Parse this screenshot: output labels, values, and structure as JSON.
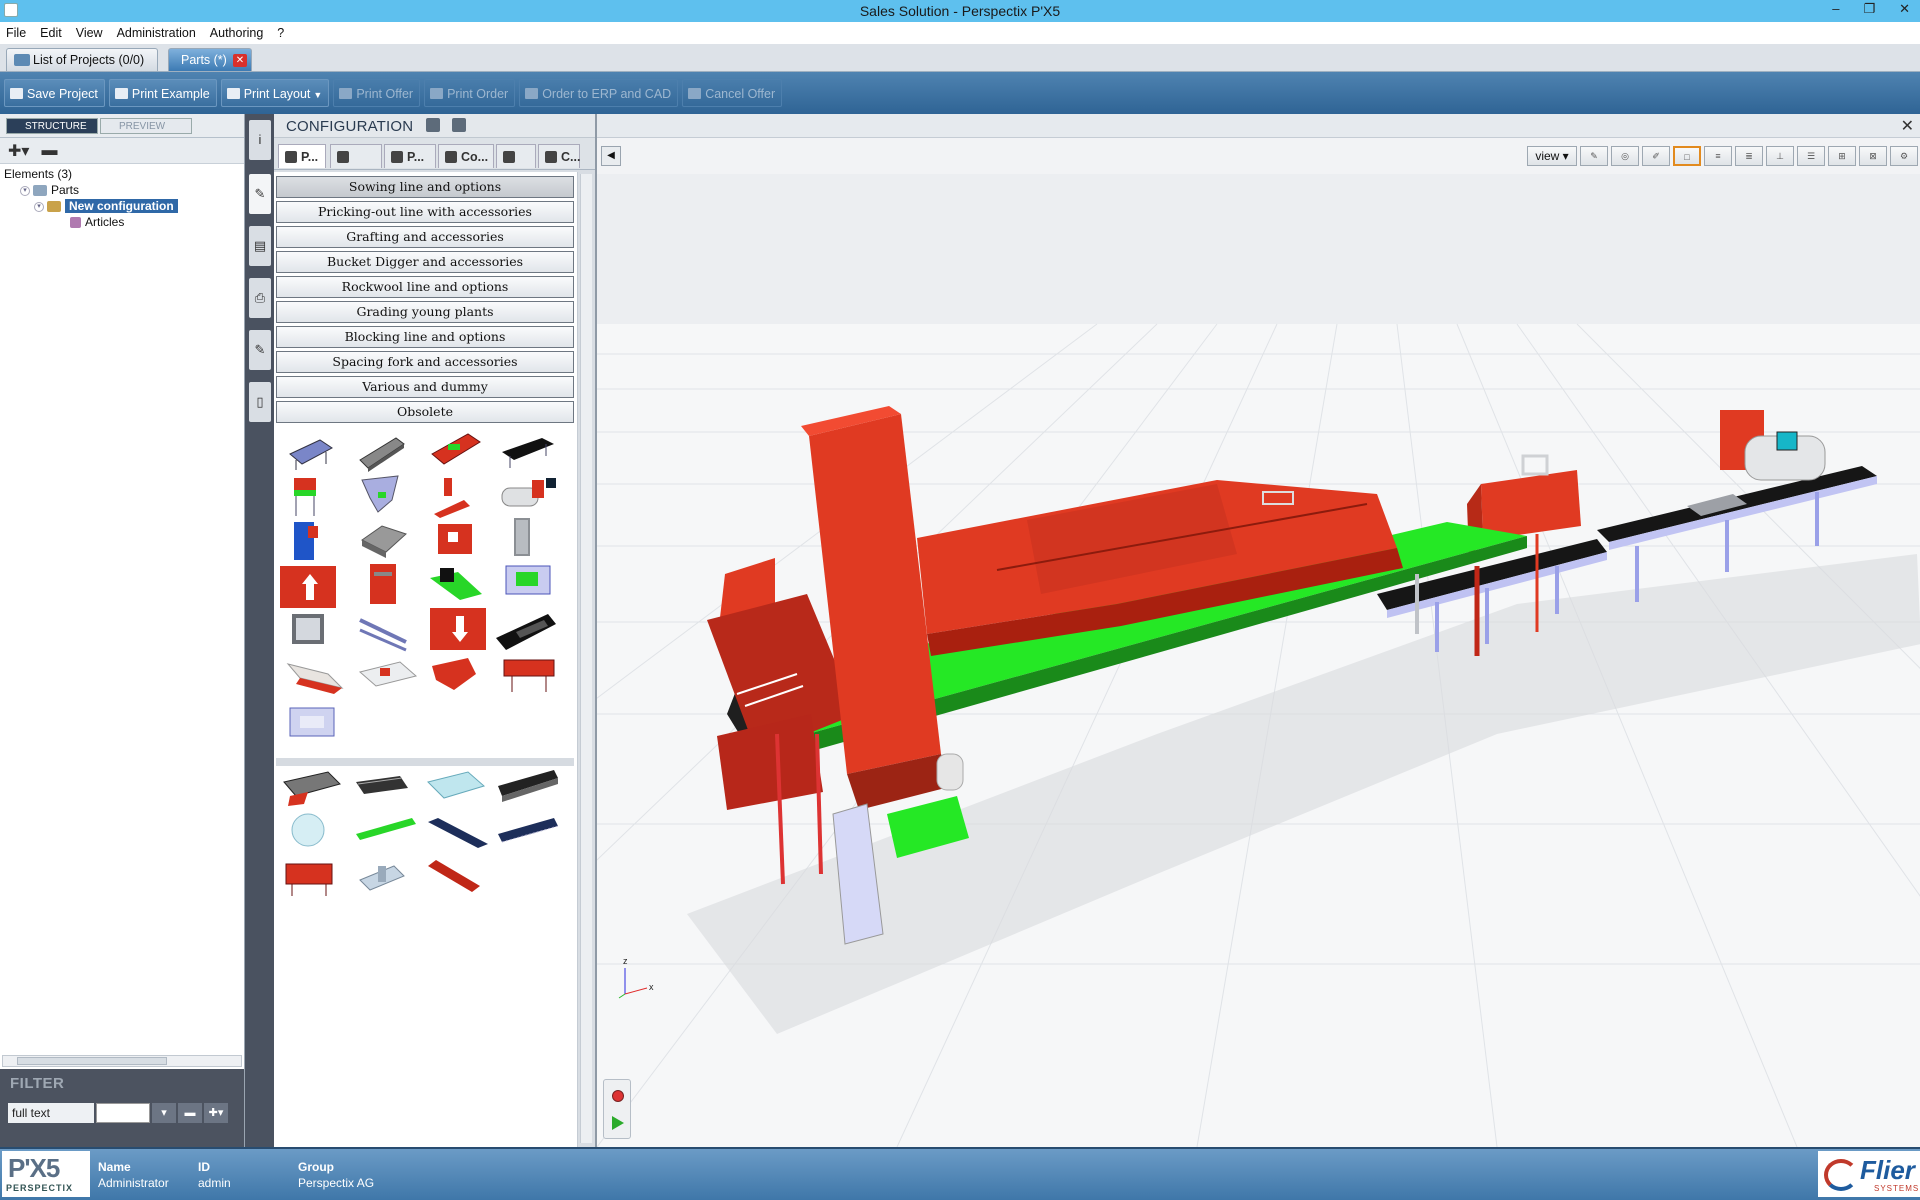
{
  "window": {
    "title": "Sales Solution - Perspectix P'X5",
    "controls": [
      "–",
      "❐",
      "✕"
    ]
  },
  "menu": [
    "File",
    "Edit",
    "View",
    "Administration",
    "Authoring",
    "?"
  ],
  "tabs": [
    {
      "label": "List of Projects (0/0)"
    },
    {
      "label": "Parts (*)"
    }
  ],
  "toolbar": {
    "buttons": [
      {
        "label": "Save Project",
        "enabled": true
      },
      {
        "label": "Print Example",
        "enabled": true
      },
      {
        "label": "Print Layout",
        "enabled": true
      },
      {
        "label": "Print Offer",
        "enabled": false
      },
      {
        "label": "Print Order",
        "enabled": false
      },
      {
        "label": "Order to ERP and CAD",
        "enabled": false
      },
      {
        "label": "Cancel Offer",
        "enabled": false
      }
    ]
  },
  "left_panel": {
    "structure_tab": "STRUCTURE",
    "preview_tab": "PREVIEW",
    "add_label": "✚▾",
    "remove_label": "▬",
    "tree": {
      "root": "Elements (3)",
      "items": [
        {
          "label": "Parts",
          "level": 1
        },
        {
          "label": "New configuration",
          "level": 2,
          "selected": true
        },
        {
          "label": "Articles",
          "level": 3
        }
      ]
    },
    "filter": {
      "title": "FILTER",
      "mode": "full text",
      "buttons": [
        "▾",
        "▬",
        "✚▾"
      ]
    }
  },
  "rail": {
    "buttons": [
      "i",
      "✎",
      "▤",
      "⎙",
      "✎",
      "▯"
    ]
  },
  "configuration": {
    "title": "CONFIGURATION",
    "tabs": [
      {
        "label": "P...",
        "active": true
      },
      {
        "label": "",
        "active": false
      },
      {
        "label": "P...",
        "active": false
      },
      {
        "label": "Co...",
        "active": false
      },
      {
        "label": "",
        "active": false
      },
      {
        "label": "C...",
        "active": false
      }
    ],
    "categories": [
      "Sowing line and options",
      "Pricking-out line with accessories",
      "Grafting and accessories",
      "Bucket Digger and accessories",
      "Rockwool line and options",
      "Grading young plants",
      "Blocking line and options",
      "Spacing fork and accessories",
      "Various and dummy",
      "Obsolete"
    ]
  },
  "viewport": {
    "view_label": "view",
    "collapse": "◀",
    "close": "✕",
    "axis_labels": {
      "z": "z",
      "x": "x"
    }
  },
  "status": {
    "logo_main": "P'X5",
    "logo_sub": "PERSPECTIX",
    "columns": [
      {
        "key": "Name",
        "value": "Administrator"
      },
      {
        "key": "ID",
        "value": "admin"
      },
      {
        "key": "Group",
        "value": "Perspectix AG"
      }
    ],
    "brand": "Flier",
    "brand_sub": "SYSTEMS"
  },
  "colors": {
    "machine_red": "#e03a22",
    "conveyor_green": "#25e825",
    "belt_black": "#161616",
    "toolbar_blue": "#3a6f9f",
    "titlebar_blue": "#5ec0ee"
  }
}
